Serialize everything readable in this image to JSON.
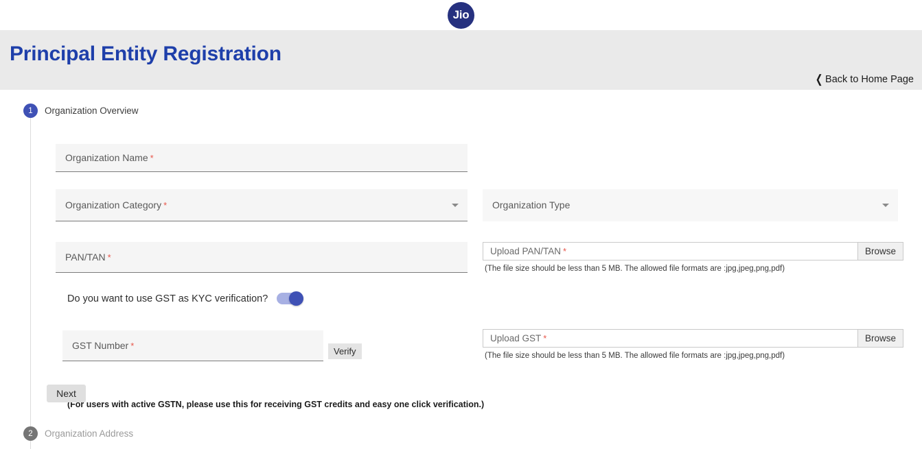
{
  "brand": {
    "logo_text": "Jio",
    "logo_color": "#26317f"
  },
  "header": {
    "title": "Principal Entity Registration",
    "title_color": "#1e3faa",
    "back_link": "Back to Home Page",
    "back_icon": "chevron-left-icon",
    "band_color": "#eaeaea"
  },
  "stepper": {
    "steps": [
      {
        "number": "1",
        "label": "Organization Overview",
        "state": "active",
        "color": "#3f51b5"
      },
      {
        "number": "2",
        "label": "Organization Address",
        "state": "inactive",
        "color": "#757575"
      }
    ]
  },
  "form": {
    "required_marker": "*",
    "organization_name": {
      "label": "Organization Name",
      "value": "",
      "required": true
    },
    "organization_category": {
      "label": "Organization Category",
      "value": "",
      "required": true,
      "icon": "chevron-down-icon"
    },
    "organization_type": {
      "label": "Organization Type",
      "value": "",
      "required": false,
      "icon": "chevron-down-icon"
    },
    "pan_tan": {
      "label": "PAN/TAN",
      "value": "",
      "required": true
    },
    "upload_pan_tan": {
      "label": "Upload PAN/TAN",
      "value": "",
      "required": true,
      "browse_label": "Browse",
      "helper": "(The file size should be less than 5 MB. The allowed file formats are :jpg,jpeg,png,pdf)"
    },
    "gst_toggle": {
      "question": "Do you want to use GST as KYC verification?",
      "state": "on",
      "note": "(For users with active GSTN, please use this for receiving GST credits and easy one click verification.)",
      "track_color": "#a7b0e3",
      "knob_color": "#3f51b5"
    },
    "gst_number": {
      "label": "GST Number",
      "value": "",
      "required": true
    },
    "verify_button": "Verify",
    "upload_gst": {
      "label": "Upload GST",
      "value": "",
      "required": true,
      "browse_label": "Browse",
      "helper": "(The file size should be less than 5 MB. The allowed file formats are :jpg,jpeg,png,pdf)"
    },
    "next_button": "Next"
  }
}
